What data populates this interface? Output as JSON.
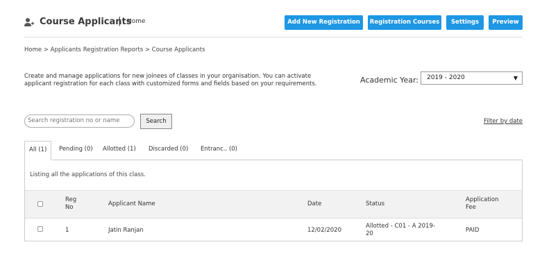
{
  "header": {
    "title": "Course Applicants",
    "separator": "|",
    "home_link": "Home",
    "buttons": {
      "add_new_registration": "Add New Registration",
      "registration_courses": "Registration Courses",
      "settings": "Settings",
      "preview": "Preview"
    },
    "button_color": "#1e97e4"
  },
  "breadcrumb": "Home > Applicants Registration Reports > Course Applicants",
  "description": "Create and manage applications for new joinees of classes in your organisation. You can activate applicant registration for each class with customized forms and fields based on your requirements.",
  "academic_year": {
    "label": "Academic Year:",
    "selected": "2019 - 2020"
  },
  "search": {
    "placeholder": "Search registration no or name",
    "button_label": "Search"
  },
  "filter_link": "Filter by date",
  "tabs": [
    {
      "label": "All (1)",
      "active": true
    },
    {
      "label": "Pending (0)",
      "active": false
    },
    {
      "label": "Allotted (1)",
      "active": false
    },
    {
      "label": "Discarded (0)",
      "active": false
    },
    {
      "label": "Entranc.. (0)",
      "active": false
    }
  ],
  "listing_text": "Listing all the applications of this class.",
  "table": {
    "columns": {
      "reg_no_line1": "Reg",
      "reg_no_line2": "No",
      "applicant_name": "Applicant Name",
      "date": "Date",
      "status": "Status",
      "fee_line1": "Application",
      "fee_line2": "Fee"
    },
    "rows": [
      {
        "reg_no": "1",
        "applicant_name": "Jatin Ranjan",
        "date": "12/02/2020",
        "status_line1": "Allotted - C01 - A 2019-",
        "status_line2": "20",
        "fee": "PAID"
      }
    ]
  }
}
